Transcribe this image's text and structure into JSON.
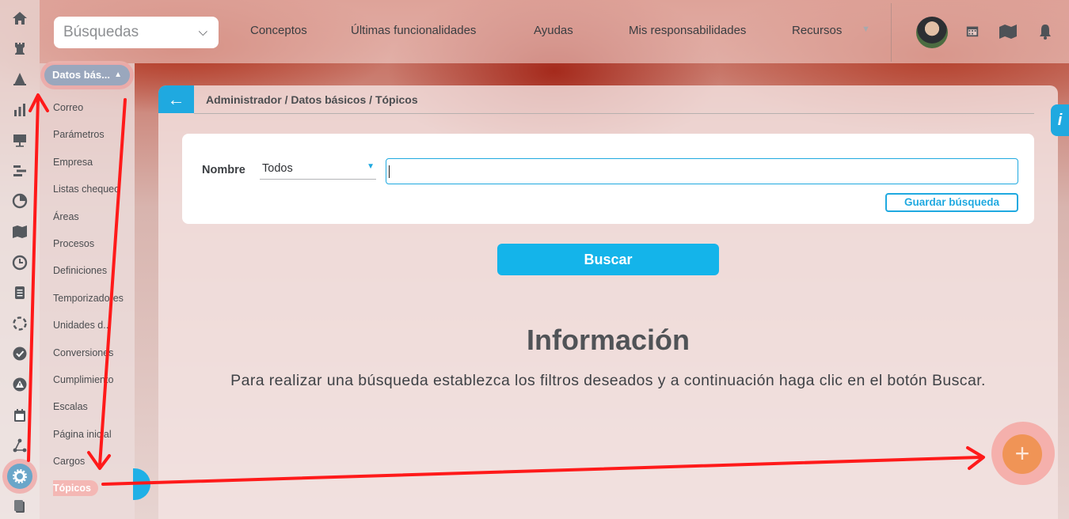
{
  "rail": {
    "icons": [
      "home-icon",
      "rook-icon",
      "cone-icon",
      "bar-chart-icon",
      "presentation-icon",
      "gantt-icon",
      "pie-chart-icon",
      "map-icon",
      "clock-icon",
      "document-icon",
      "cycle-icon",
      "check-circle-icon",
      "warning-icon",
      "calendar-icon",
      "network-icon",
      "gear-icon",
      "files-icon"
    ],
    "active": "gear-icon"
  },
  "submenu": {
    "header": "Datos bás...",
    "items": [
      "Correo",
      "Parámetros",
      "Empresa",
      "Listas chequeo",
      "Áreas",
      "Procesos",
      "Definiciones",
      "Temporizadores",
      "Unidades d...",
      "Conversiones",
      "Cumplimiento",
      "Escalas",
      "Página inicial",
      "Cargos",
      "Tópicos"
    ],
    "selected": "Tópicos"
  },
  "topbar": {
    "search_select": "Búsquedas",
    "nav": [
      "Conceptos",
      "Últimas funcionalidades",
      "Ayudas",
      "Mis responsabilidades",
      "Recursos"
    ],
    "icons": [
      "calendar-icon",
      "map-icon",
      "bell-icon"
    ]
  },
  "main": {
    "breadcrumb": "Administrador / Datos básicos / Tópicos",
    "filter": {
      "label": "Nombre",
      "select_value": "Todos",
      "input_value": "",
      "save_button": "Guardar búsqueda"
    },
    "search_button": "Buscar",
    "info_title": "Información",
    "info_text": "Para realizar una búsqueda establezca los filtros deseados y a continuación haga clic en el botón Buscar."
  },
  "fab": "+",
  "info_tab": "i",
  "colors": {
    "accent": "#1fa9e0",
    "fab": "#f09456",
    "annotation": "#ff1a1a"
  }
}
